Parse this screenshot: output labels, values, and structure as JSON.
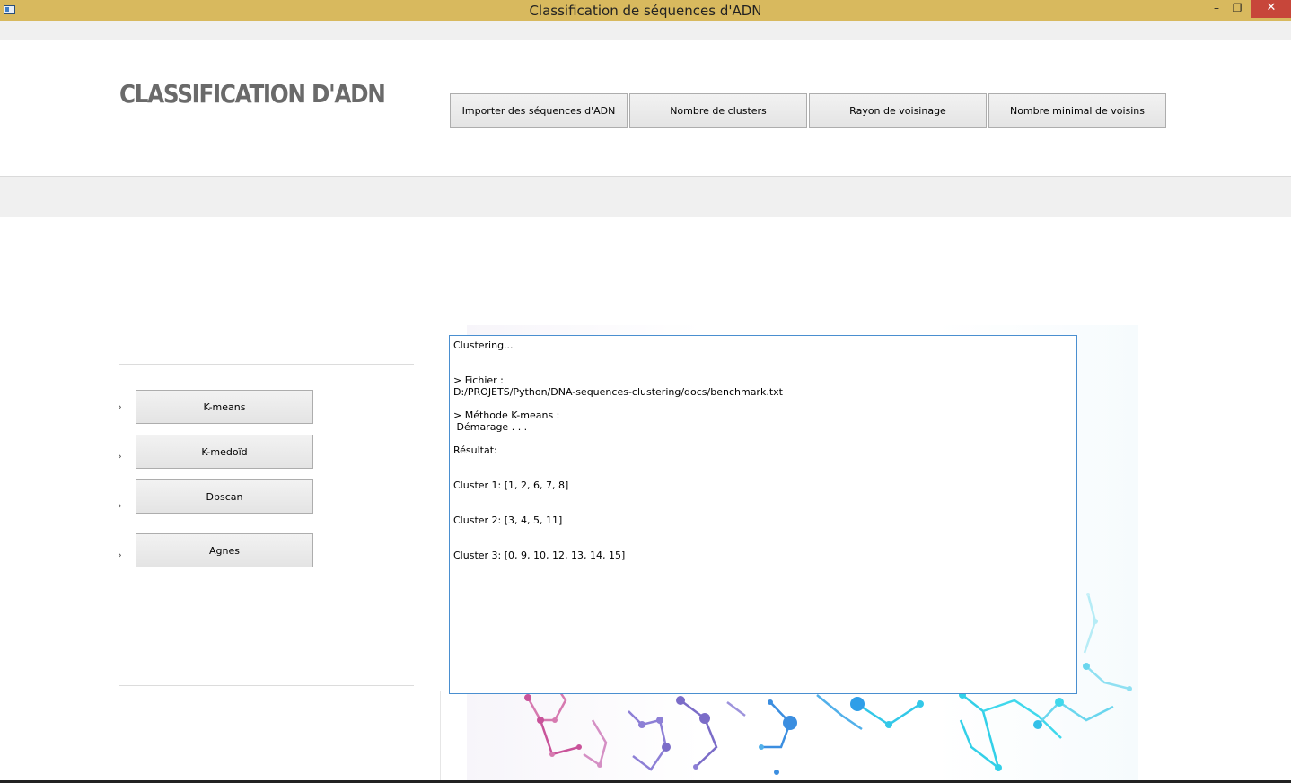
{
  "window": {
    "title": "Classification de séquences d'ADN",
    "minimize_glyph": "–",
    "restore_glyph": "❐",
    "close_glyph": "✕"
  },
  "header": {
    "app_title": "CLASSIFICATION D'ADN",
    "buttons": [
      {
        "label": "Importer des séquences d'ADN"
      },
      {
        "label": "Nombre de clusters"
      },
      {
        "label": "Rayon de voisinage"
      },
      {
        "label": "Nombre minimal de voisins"
      }
    ]
  },
  "algorithms": {
    "chevron_glyph": "›",
    "items": [
      {
        "label": "K-means"
      },
      {
        "label": "K-medoïd"
      },
      {
        "label": "Dbscan"
      },
      {
        "label": "Agnes"
      }
    ]
  },
  "output": {
    "text": "Clustering...\n\n\n> Fichier :\nD:/PROJETS/Python/DNA-sequences-clustering/docs/benchmark.txt\n\n> Méthode K-means :\n Démarage . . .\n\nRésultat:\n\n\nCluster 1: [1, 2, 6, 7, 8]\n\n\nCluster 2: [3, 4, 5, 11]\n\n\nCluster 3: [0, 9, 10, 12, 13, 14, 15]"
  },
  "colors": {
    "titlebar": "#d8b95e",
    "close_button": "#c7463a",
    "output_border": "#4a8fd0",
    "molecule_pink": "#c9539a",
    "molecule_purple": "#7b6cc8",
    "molecule_blue": "#3b8ee0",
    "molecule_cyan": "#33d0e8"
  },
  "icons": {
    "app": "window-app-icon",
    "background": "dna-molecule-illustration"
  }
}
